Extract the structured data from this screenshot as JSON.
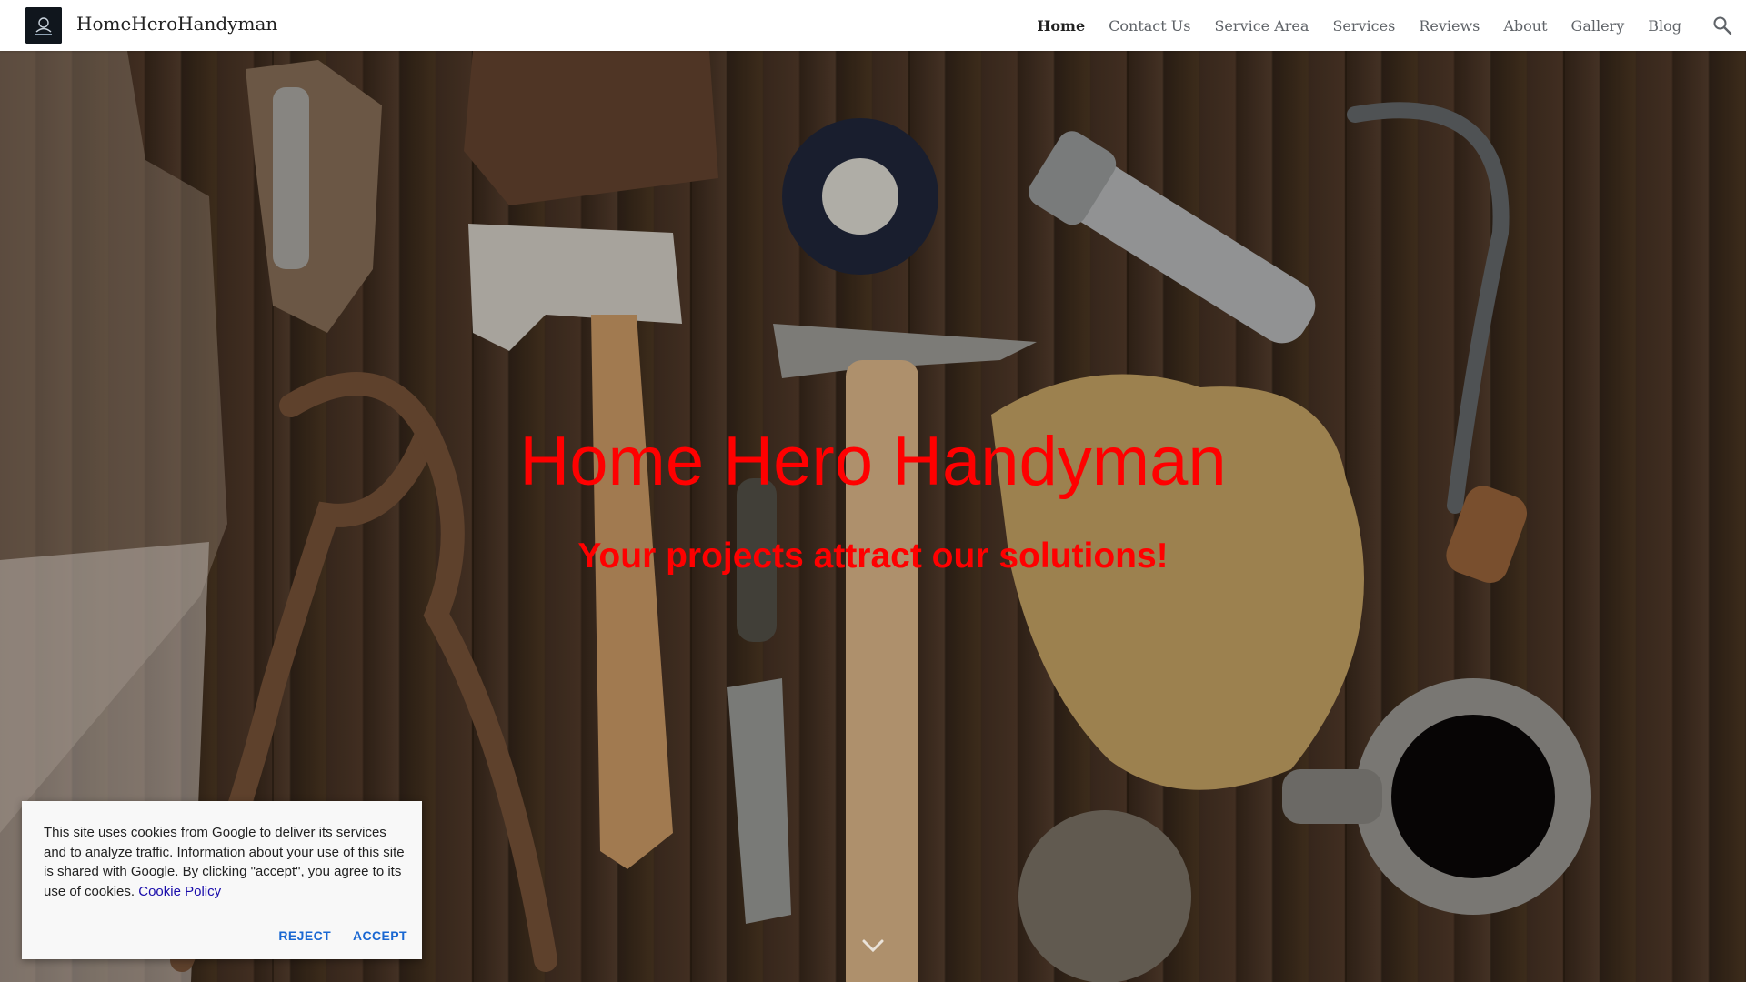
{
  "header": {
    "site_title": "HomeHeroHandyman",
    "nav": [
      {
        "label": "Home",
        "active": true
      },
      {
        "label": "Contact Us",
        "active": false
      },
      {
        "label": "Service Area",
        "active": false
      },
      {
        "label": "Services",
        "active": false
      },
      {
        "label": "Reviews",
        "active": false
      },
      {
        "label": "About",
        "active": false
      },
      {
        "label": "Gallery",
        "active": false
      },
      {
        "label": "Blog",
        "active": false
      }
    ],
    "search_icon": "search-icon"
  },
  "hero": {
    "title": "Home Hero Handyman",
    "subtitle": "Your projects attract our solutions!",
    "title_color": "#ff0000",
    "scroll_icon": "chevron-down-icon"
  },
  "cookie": {
    "text": "This site uses cookies from Google to deliver its services and to analyze traffic. Information about your use of this site is shared with Google. By clicking \"accept\", you agree to its use of cookies. ",
    "link_label": "Cookie Policy",
    "reject_label": "REJECT",
    "accept_label": "ACCEPT",
    "button_color": "#1967d2"
  }
}
